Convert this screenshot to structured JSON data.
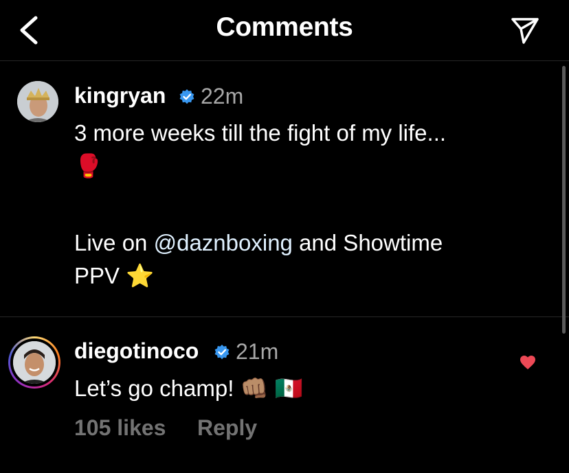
{
  "header": {
    "title": "Comments",
    "back_icon": "chevron-left-icon",
    "send_icon": "paper-plane-icon"
  },
  "caption": {
    "username": "kingryan",
    "verified": true,
    "time": "22m",
    "line1": "3 more weeks till the fight of my life...",
    "line2_emoji": "🥊",
    "line3_prefix": "Live on ",
    "mention": "@daznboxing",
    "line3_suffix": " and Showtime",
    "line4": "PPV ⭐"
  },
  "comment": {
    "username": "diegotinoco",
    "verified": true,
    "time": "21m",
    "text": "Let’s go champ! 👊🏽 🇲🇽",
    "likes": "105 likes",
    "reply": "Reply",
    "liked": true
  },
  "colors": {
    "background": "#000000",
    "verified": "#3897f0",
    "heart": "#ed4956",
    "muted": "#a8a8a8",
    "mention": "#e0f1ff"
  }
}
